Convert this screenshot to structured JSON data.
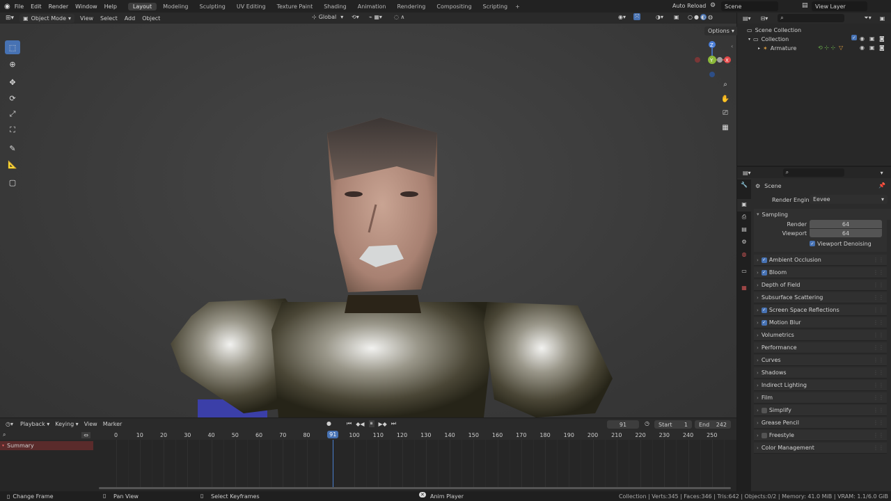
{
  "topbar": {
    "menus": [
      "File",
      "Edit",
      "Render",
      "Window",
      "Help"
    ],
    "workspaces": [
      "Layout",
      "Modeling",
      "Sculpting",
      "UV Editing",
      "Texture Paint",
      "Shading",
      "Animation",
      "Rendering",
      "Compositing",
      "Scripting"
    ],
    "active_workspace": "Layout",
    "add_tab": "+",
    "auto_reload": "Auto Reload",
    "scene": "Scene",
    "view_layer": "View Layer"
  },
  "viewport_header": {
    "mode": "Object Mode",
    "menus": [
      "View",
      "Select",
      "Add",
      "Object"
    ],
    "transform": "Global",
    "options": "Options"
  },
  "gizmo": {
    "x": "X",
    "y": "Y",
    "z": "Z"
  },
  "outliner": {
    "scene_collection": "Scene Collection",
    "collection": "Collection",
    "armature": "Armature"
  },
  "properties": {
    "title": "Scene",
    "render_engine_label": "Render Engine",
    "render_engine_value": "Eevee",
    "sampling": "Sampling",
    "render_label": "Render",
    "render_value": "64",
    "viewport_label": "Viewport",
    "viewport_value": "64",
    "viewport_denoising": "Viewport Denoising",
    "panels": [
      {
        "label": "Ambient Occlusion",
        "checkbox": "on"
      },
      {
        "label": "Bloom",
        "checkbox": "on"
      },
      {
        "label": "Depth of Field",
        "checkbox": "none"
      },
      {
        "label": "Subsurface Scattering",
        "checkbox": "none"
      },
      {
        "label": "Screen Space Reflections",
        "checkbox": "on"
      },
      {
        "label": "Motion Blur",
        "checkbox": "on"
      },
      {
        "label": "Volumetrics",
        "checkbox": "none"
      },
      {
        "label": "Performance",
        "checkbox": "none"
      },
      {
        "label": "Curves",
        "checkbox": "none"
      },
      {
        "label": "Shadows",
        "checkbox": "none"
      },
      {
        "label": "Indirect Lighting",
        "checkbox": "none"
      },
      {
        "label": "Film",
        "checkbox": "none"
      },
      {
        "label": "Simplify",
        "checkbox": "off"
      },
      {
        "label": "Grease Pencil",
        "checkbox": "none"
      },
      {
        "label": "Freestyle",
        "checkbox": "off"
      },
      {
        "label": "Color Management",
        "checkbox": "none"
      }
    ]
  },
  "timeline": {
    "menus": [
      "Playback",
      "Keying",
      "View",
      "Marker"
    ],
    "current_frame": "91",
    "start_label": "Start",
    "start_value": "1",
    "end_label": "End",
    "end_value": "242",
    "summary": "Summary",
    "ticks": [
      "0",
      "10",
      "20",
      "30",
      "40",
      "50",
      "60",
      "70",
      "80",
      "91",
      "100",
      "110",
      "120",
      "130",
      "140",
      "150",
      "160",
      "170",
      "180",
      "190",
      "200",
      "210",
      "220",
      "230",
      "240",
      "250"
    ]
  },
  "statusbar": {
    "change_frame": "Change Frame",
    "pan_view": "Pan View",
    "select_keyframes": "Select Keyframes",
    "anim_player": "Anim Player",
    "stats": "Collection | Verts:345 | Faces:346 | Tris:642 | Objects:0/2 | Memory: 41.0 MiB | VRAM: 1.1/6.0 GiB"
  }
}
